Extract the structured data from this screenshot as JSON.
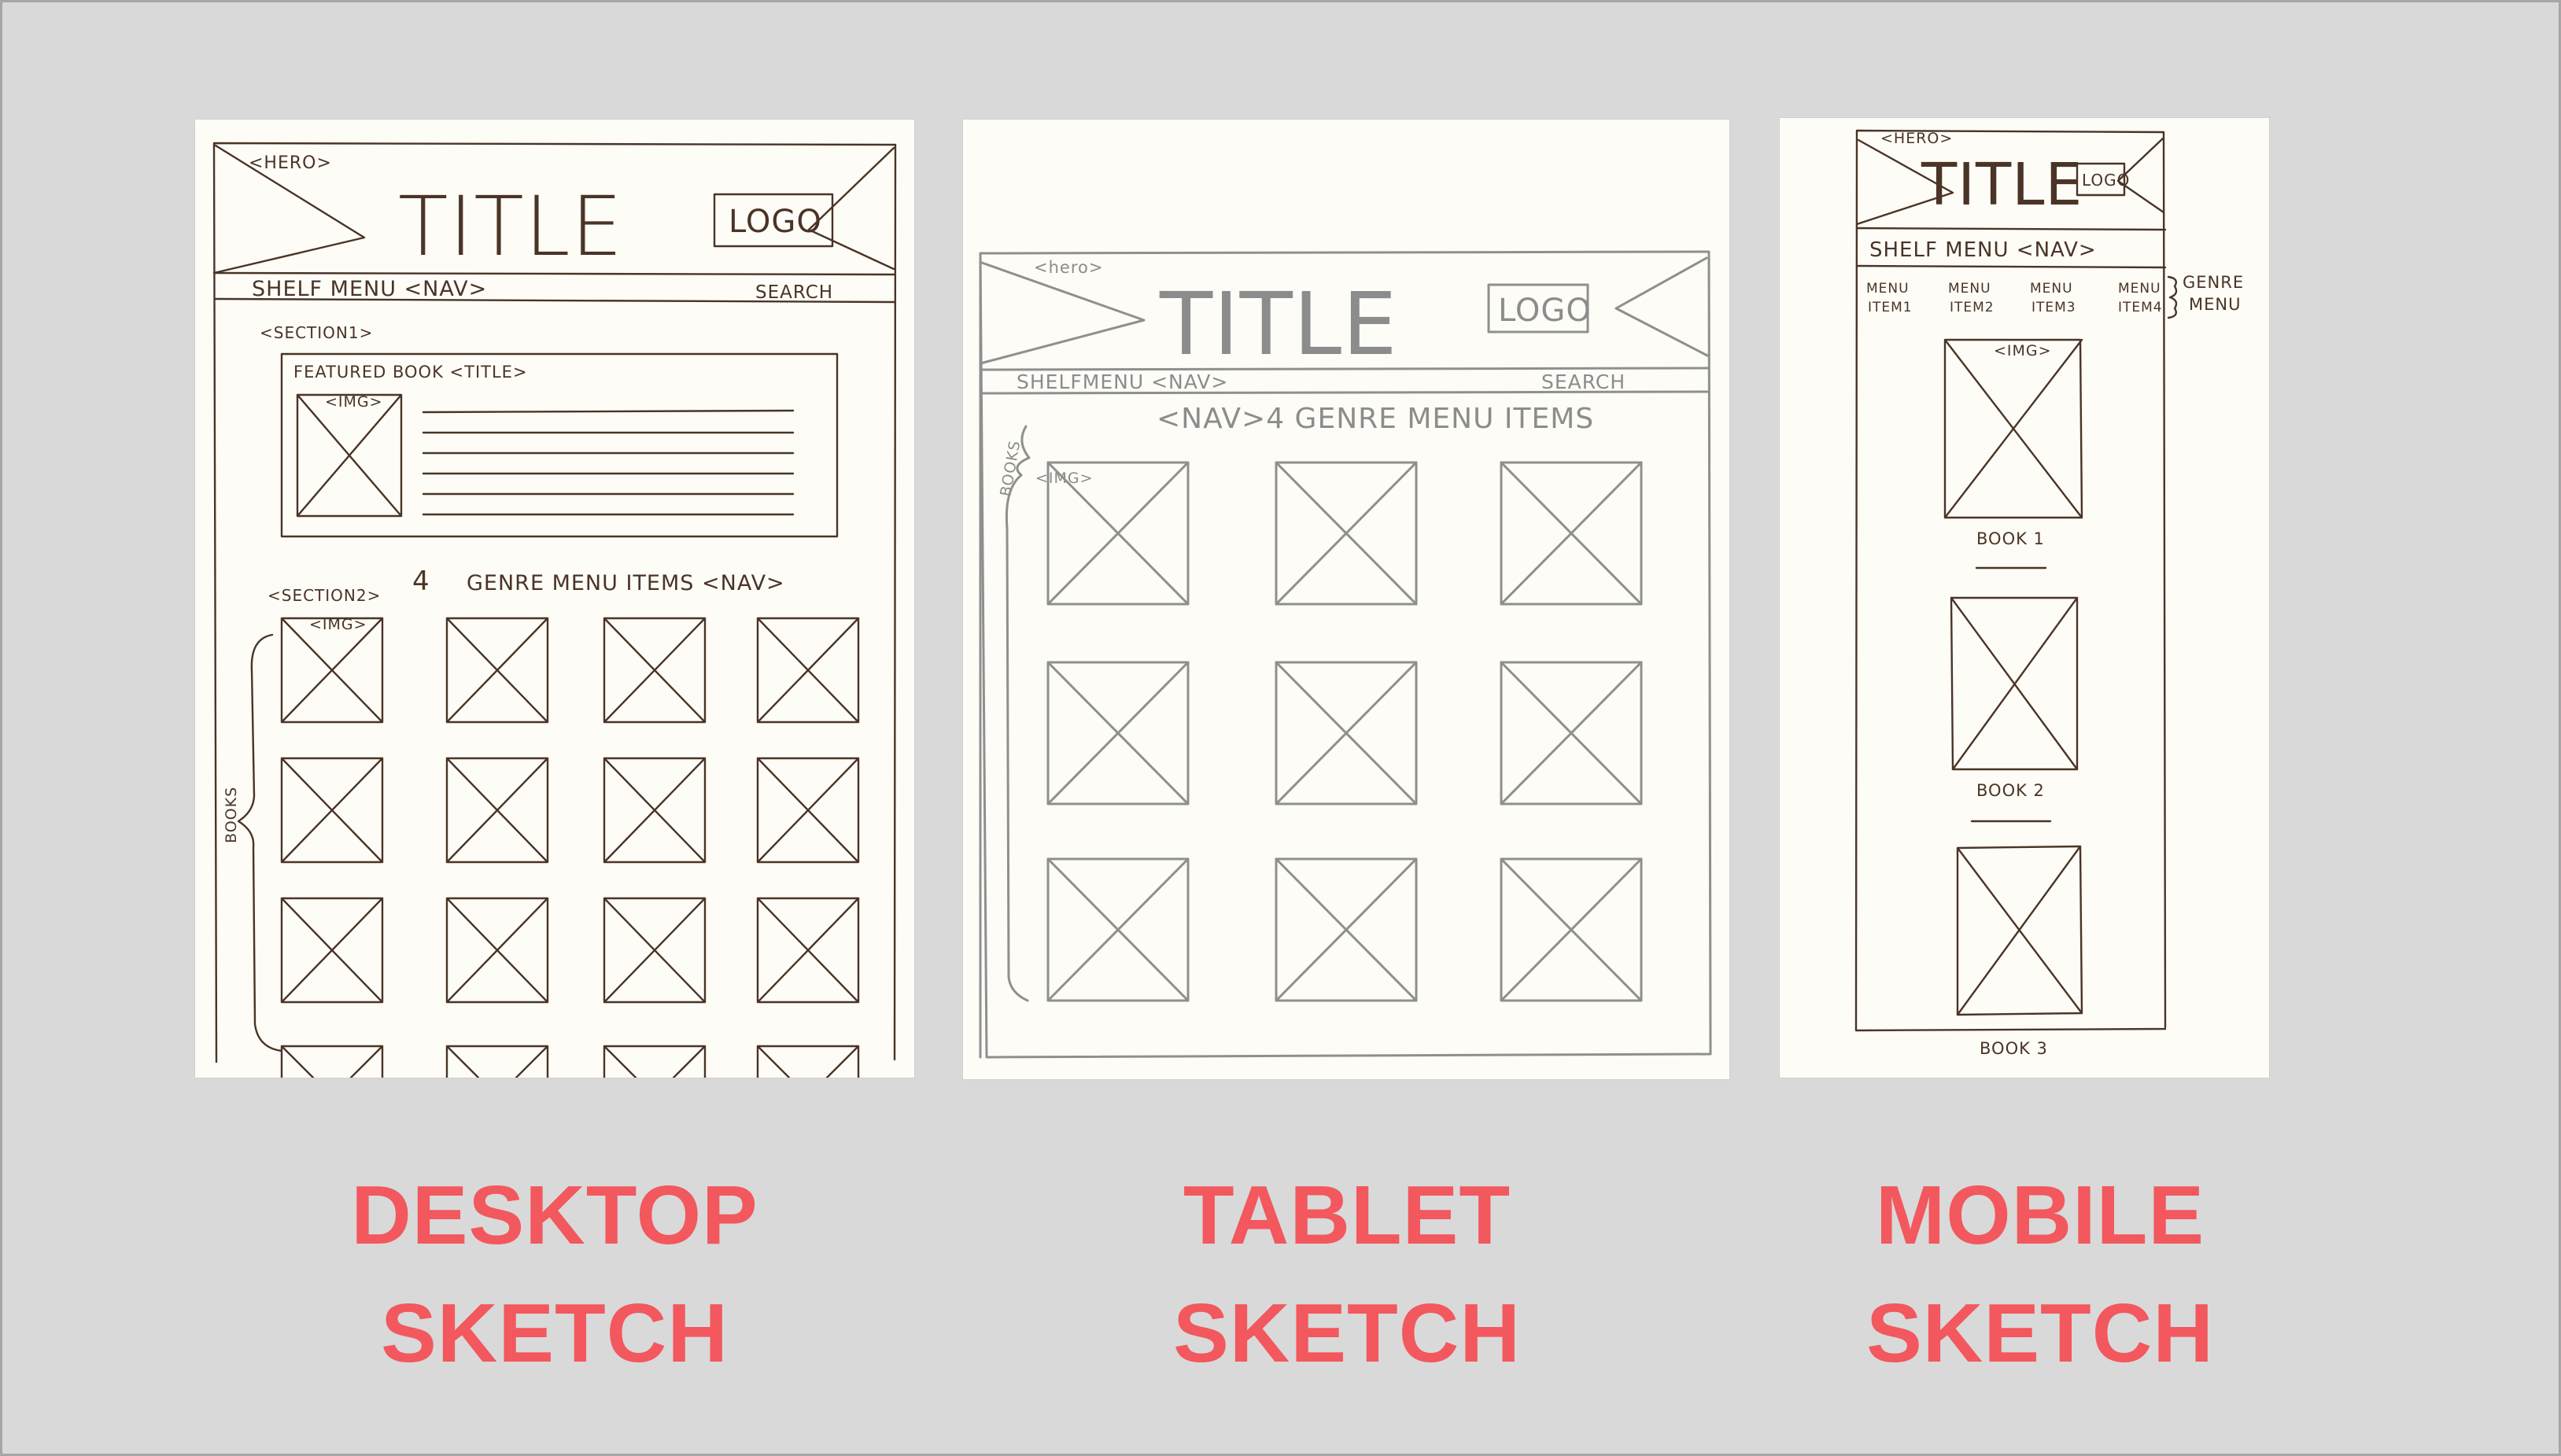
{
  "sketches": {
    "desktop": {
      "caption_line1": "DESKTOP",
      "caption_line2": "SKETCH",
      "hero_tag": "<HERO>",
      "title": "TITLE",
      "logo": "LOGO",
      "nav": "SHELF MENU <NAV>",
      "search": "SEARCH",
      "section1": "<SECTION1>",
      "featured": "FEATURED BOOK <TITLE>",
      "img_tag": "<IMG>",
      "section2": "<SECTION2>",
      "genre_count": "4",
      "genre_items": "GENRE MENU ITEMS <NAV>",
      "img_tag2": "<IMG>",
      "books": "BOOKS"
    },
    "tablet": {
      "caption_line1": "TABLET",
      "caption_line2": "SKETCH",
      "hero_tag": "<hero>",
      "title": "TITLE",
      "logo": "LOGO",
      "nav": "SHELFMENU <NAV>",
      "search": "SEARCH",
      "genre_items": "<NAV>4 GENRE MENU ITEMS",
      "img_tag": "<IMG>",
      "books": "BOOKS"
    },
    "mobile": {
      "caption_line1": "MOBILE",
      "caption_line2": "SKETCH",
      "hero_tag": "<HERO>",
      "title": "TITLE",
      "logo": "LOGO",
      "nav": "SHELF MENU <NAV>",
      "menu_items": [
        {
          "l1": "MENU",
          "l2": "ITEM1"
        },
        {
          "l1": "MENU",
          "l2": "ITEM2"
        },
        {
          "l1": "MENU",
          "l2": "ITEM3"
        },
        {
          "l1": "MENU",
          "l2": "ITEM4"
        }
      ],
      "genre_note_l1": "GENRE",
      "genre_note_l2": "MENU",
      "img_tag": "<IMG>",
      "books": [
        "BOOK 1",
        "BOOK 2",
        "BOOK 3"
      ]
    }
  },
  "colors": {
    "background": "#d9d9d9",
    "paper": "#fdfcf7",
    "caption": "#f2585d",
    "ink": "#4a3426",
    "pencil": "#8f8f8f"
  }
}
